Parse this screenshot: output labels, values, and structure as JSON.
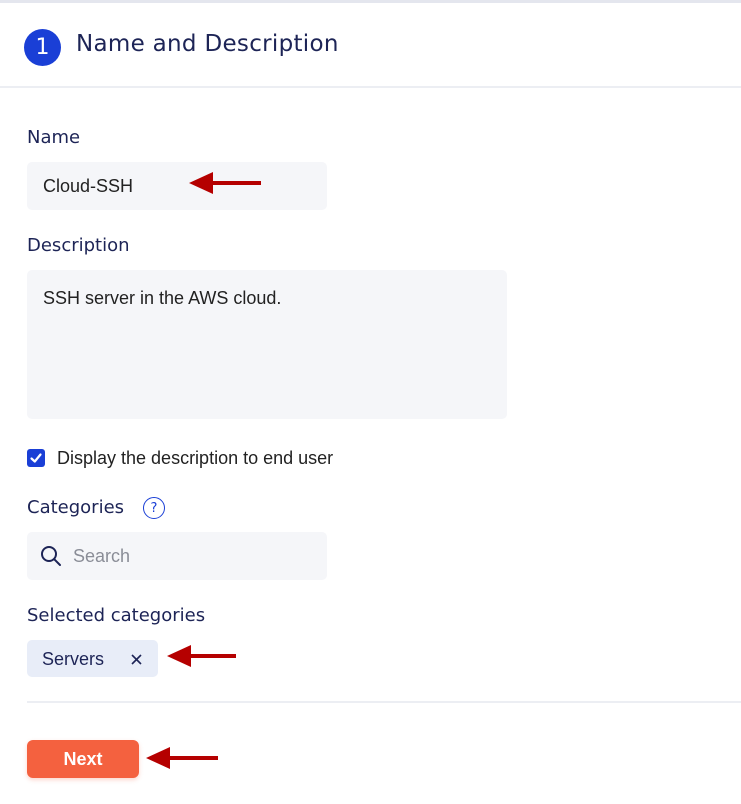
{
  "step": {
    "number": "1",
    "title": "Name and Description"
  },
  "name_field": {
    "label": "Name",
    "value": "Cloud-SSH"
  },
  "description_field": {
    "label": "Description",
    "value": "SSH server in the AWS cloud."
  },
  "display_checkbox": {
    "label": "Display the description to end user",
    "checked": true
  },
  "categories": {
    "label": "Categories",
    "help_icon": "question-circle-icon",
    "search_placeholder": "Search",
    "search_icon": "search-icon"
  },
  "selected_categories": {
    "label": "Selected categories",
    "chips": [
      {
        "label": "Servers",
        "remove_icon": "close-icon"
      }
    ]
  },
  "actions": {
    "next_label": "Next"
  },
  "colors": {
    "accent_blue": "#1a3fd6",
    "button_orange": "#f4613f",
    "annotation_red": "#b50000",
    "input_bg": "#f5f6f9",
    "chip_bg": "#e8edf8"
  }
}
